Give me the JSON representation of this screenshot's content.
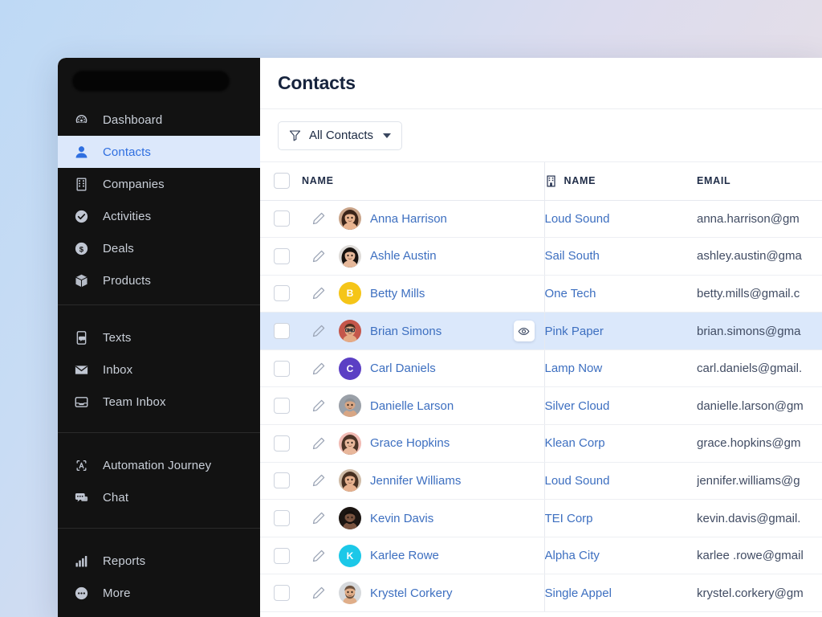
{
  "sidebar": {
    "logo_redacted": true,
    "groups": [
      {
        "name": "main",
        "items": [
          {
            "label": "Dashboard",
            "icon": "dashboard-gauge-icon",
            "active": false
          },
          {
            "label": "Contacts",
            "icon": "person-icon",
            "active": true
          },
          {
            "label": "Companies",
            "icon": "building-icon",
            "active": false
          },
          {
            "label": "Activities",
            "icon": "check-circle-icon",
            "active": false
          },
          {
            "label": "Deals",
            "icon": "dollar-circle-icon",
            "active": false
          },
          {
            "label": "Products",
            "icon": "box-icon",
            "active": false
          }
        ]
      },
      {
        "name": "communication",
        "items": [
          {
            "label": "Texts",
            "icon": "phone-message-icon",
            "active": false
          },
          {
            "label": "Inbox",
            "icon": "envelope-icon",
            "active": false
          },
          {
            "label": "Team Inbox",
            "icon": "inbox-tray-icon",
            "active": false
          }
        ]
      },
      {
        "name": "automation",
        "items": [
          {
            "label": "Automation Journey",
            "icon": "automation-loop-icon",
            "active": false
          },
          {
            "label": "Chat",
            "icon": "chat-bubbles-icon",
            "active": false
          }
        ]
      },
      {
        "name": "reports",
        "items": [
          {
            "label": "Reports",
            "icon": "bar-chart-icon",
            "active": false
          },
          {
            "label": "More",
            "icon": "ellipsis-circle-icon",
            "active": false
          }
        ]
      }
    ]
  },
  "header": {
    "title": "Contacts"
  },
  "toolbar": {
    "filter_label": "All Contacts",
    "filter_icon": "funnel-icon",
    "caret_icon": "chevron-down-icon"
  },
  "table": {
    "columns": [
      {
        "key": "check",
        "label": ""
      },
      {
        "key": "name",
        "label": "NAME"
      },
      {
        "key": "company",
        "label": "NAME",
        "icon": "building-icon"
      },
      {
        "key": "email",
        "label": "EMAIL"
      }
    ],
    "rows": [
      {
        "name": "Anna Harrison",
        "company": "Loud Sound",
        "email": "anna.harrison@gm",
        "avatar": {
          "type": "photo",
          "kind": "woman-dark-hair",
          "bg": "#3c2e28"
        },
        "highlight": false,
        "eye": false
      },
      {
        "name": "Ashle Austin",
        "company": "Sail South",
        "email": "ashley.austin@gma",
        "avatar": {
          "type": "photo",
          "kind": "woman-black-hair",
          "bg": "#d8d6d4"
        },
        "highlight": false,
        "eye": false
      },
      {
        "name": "Betty Mills",
        "company": "One Tech",
        "email": "betty.mills@gmail.c",
        "avatar": {
          "type": "initial",
          "initial": "B",
          "bg": "#f5c518"
        },
        "highlight": false,
        "eye": false
      },
      {
        "name": "Brian Simons",
        "company": "Pink Paper",
        "email": "brian.simons@gma",
        "avatar": {
          "type": "photo",
          "kind": "man-glasses",
          "bg": "#b8564a"
        },
        "highlight": true,
        "eye": true
      },
      {
        "name": "Carl Daniels",
        "company": "Lamp Now",
        "email": "carl.daniels@gmail.",
        "avatar": {
          "type": "initial",
          "initial": "C",
          "bg": "#5b3fc4"
        },
        "highlight": false,
        "eye": false
      },
      {
        "name": "Danielle Larson",
        "company": "Silver Cloud",
        "email": "danielle.larson@gm",
        "avatar": {
          "type": "photo",
          "kind": "man-beard-gray",
          "bg": "#8c939c"
        },
        "highlight": false,
        "eye": false
      },
      {
        "name": "Grace Hopkins",
        "company": "Klean Corp",
        "email": "grace.hopkins@gm",
        "avatar": {
          "type": "photo",
          "kind": "woman-long-hair",
          "bg": "#f1b9b2"
        },
        "highlight": false,
        "eye": false
      },
      {
        "name": "Jennifer Williams",
        "company": "Loud Sound",
        "email": "jennifer.williams@g",
        "avatar": {
          "type": "photo",
          "kind": "woman-brown-hair",
          "bg": "#cfbba6"
        },
        "highlight": false,
        "eye": false
      },
      {
        "name": "Kevin Davis",
        "company": "TEI Corp",
        "email": "kevin.davis@gmail.",
        "avatar": {
          "type": "photo",
          "kind": "man-dark",
          "bg": "#1c1612"
        },
        "highlight": false,
        "eye": false
      },
      {
        "name": "Karlee Rowe",
        "company": "Alpha City",
        "email": "karlee .rowe@gmail",
        "avatar": {
          "type": "initial",
          "initial": "K",
          "bg": "#1cc8e8"
        },
        "highlight": false,
        "eye": false
      },
      {
        "name": "Krystel Corkery",
        "company": "Single Appel",
        "email": "krystel.corkery@gm",
        "avatar": {
          "type": "photo",
          "kind": "man-beard-blond",
          "bg": "#d4d7da"
        },
        "highlight": false,
        "eye": false
      }
    ]
  },
  "colors": {
    "sidebar_bg": "#121212",
    "sidebar_active_bg": "#dce8fb",
    "accent_blue": "#3d6fc0",
    "row_highlight": "#dbe8fb",
    "title_color": "#16233d"
  }
}
